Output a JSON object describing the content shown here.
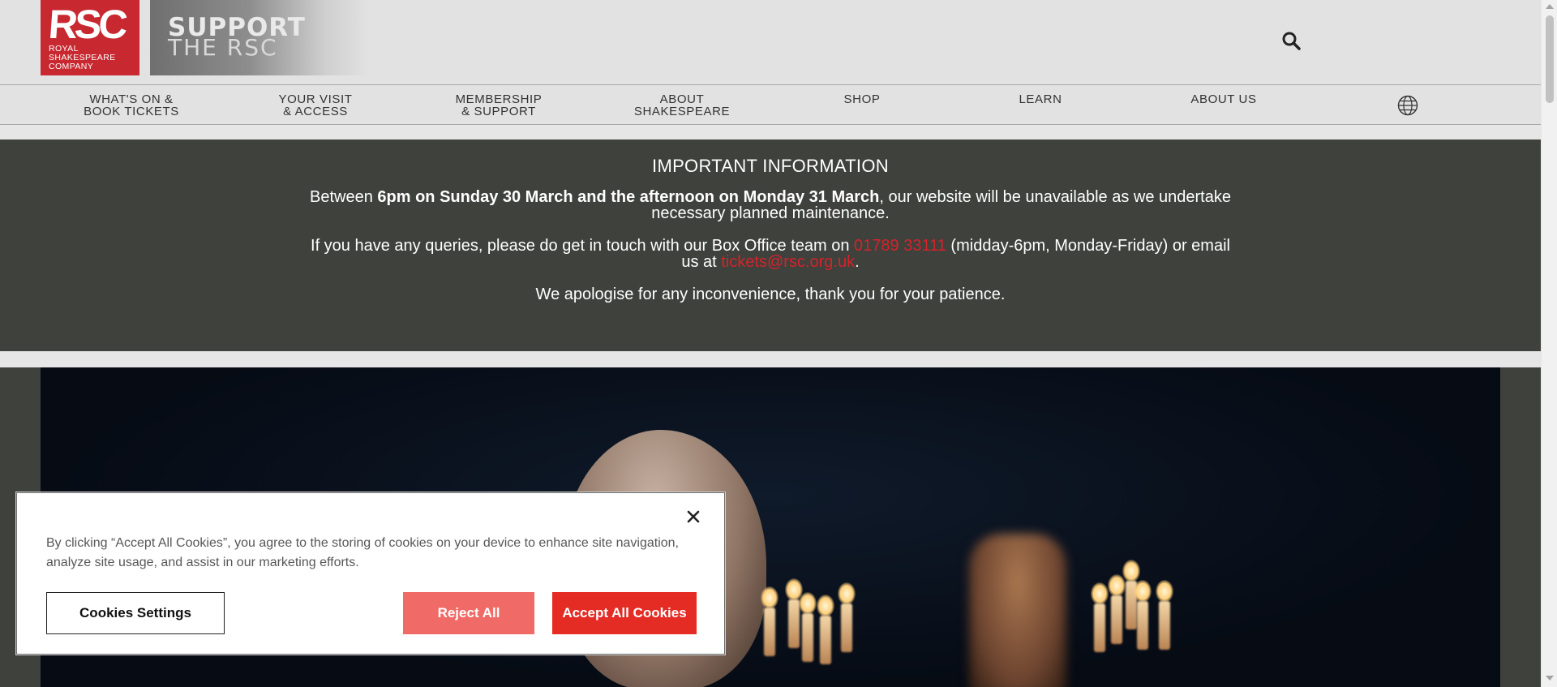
{
  "header": {
    "logo": {
      "mark": "RSC",
      "line1": "ROYAL",
      "line2": "SHAKESPEARE",
      "line3": "COMPANY"
    },
    "support_banner": {
      "line1": "SUPPORT",
      "line2": "THE RSC"
    },
    "search_icon": "search-icon"
  },
  "nav": {
    "items": [
      {
        "line1": "WHAT'S ON &",
        "line2": "BOOK TICKETS"
      },
      {
        "line1": "YOUR VISIT",
        "line2": "& ACCESS"
      },
      {
        "line1": "MEMBERSHIP",
        "line2": "& SUPPORT"
      },
      {
        "line1": "ABOUT",
        "line2": "SHAKESPEARE"
      },
      {
        "line1": "SHOP",
        "line2": ""
      },
      {
        "line1": "LEARN",
        "line2": ""
      },
      {
        "line1": "ABOUT US",
        "line2": ""
      }
    ],
    "language_icon": "globe-icon"
  },
  "notice": {
    "title": "IMPORTANT INFORMATION",
    "p1_before": "Between ",
    "p1_bold": "6pm on Sunday 30 March and the afternoon on Monday 31 March",
    "p1_after": ", our website will be unavailable as we undertake necessary planned maintenance.",
    "p2_before": "If you have any queries, please do get in touch with our Box Office team on ",
    "p2_phone": "01789 33111",
    "p2_middle": " (midday-6pm, Monday-Friday) or email us at ",
    "p2_email": "tickets@rsc.org.uk",
    "p2_after": ".",
    "p3": "We apologise for any inconvenience, thank you for your patience."
  },
  "cookie_banner": {
    "text": "By clicking “Accept All Cookies”, you agree to the storing of cookies on your device to enhance site navigation, analyze site usage, and assist in our marketing efforts.",
    "settings_label": "Cookies Settings",
    "reject_label": "Reject All",
    "accept_label": "Accept All Cookies",
    "close_icon": "close-icon"
  },
  "colors": {
    "brand_red": "#c8282f",
    "notice_bg": "#3e413c",
    "link_red": "#d4232b",
    "reject_bg": "#f06b67",
    "accept_bg": "#e42c25"
  }
}
